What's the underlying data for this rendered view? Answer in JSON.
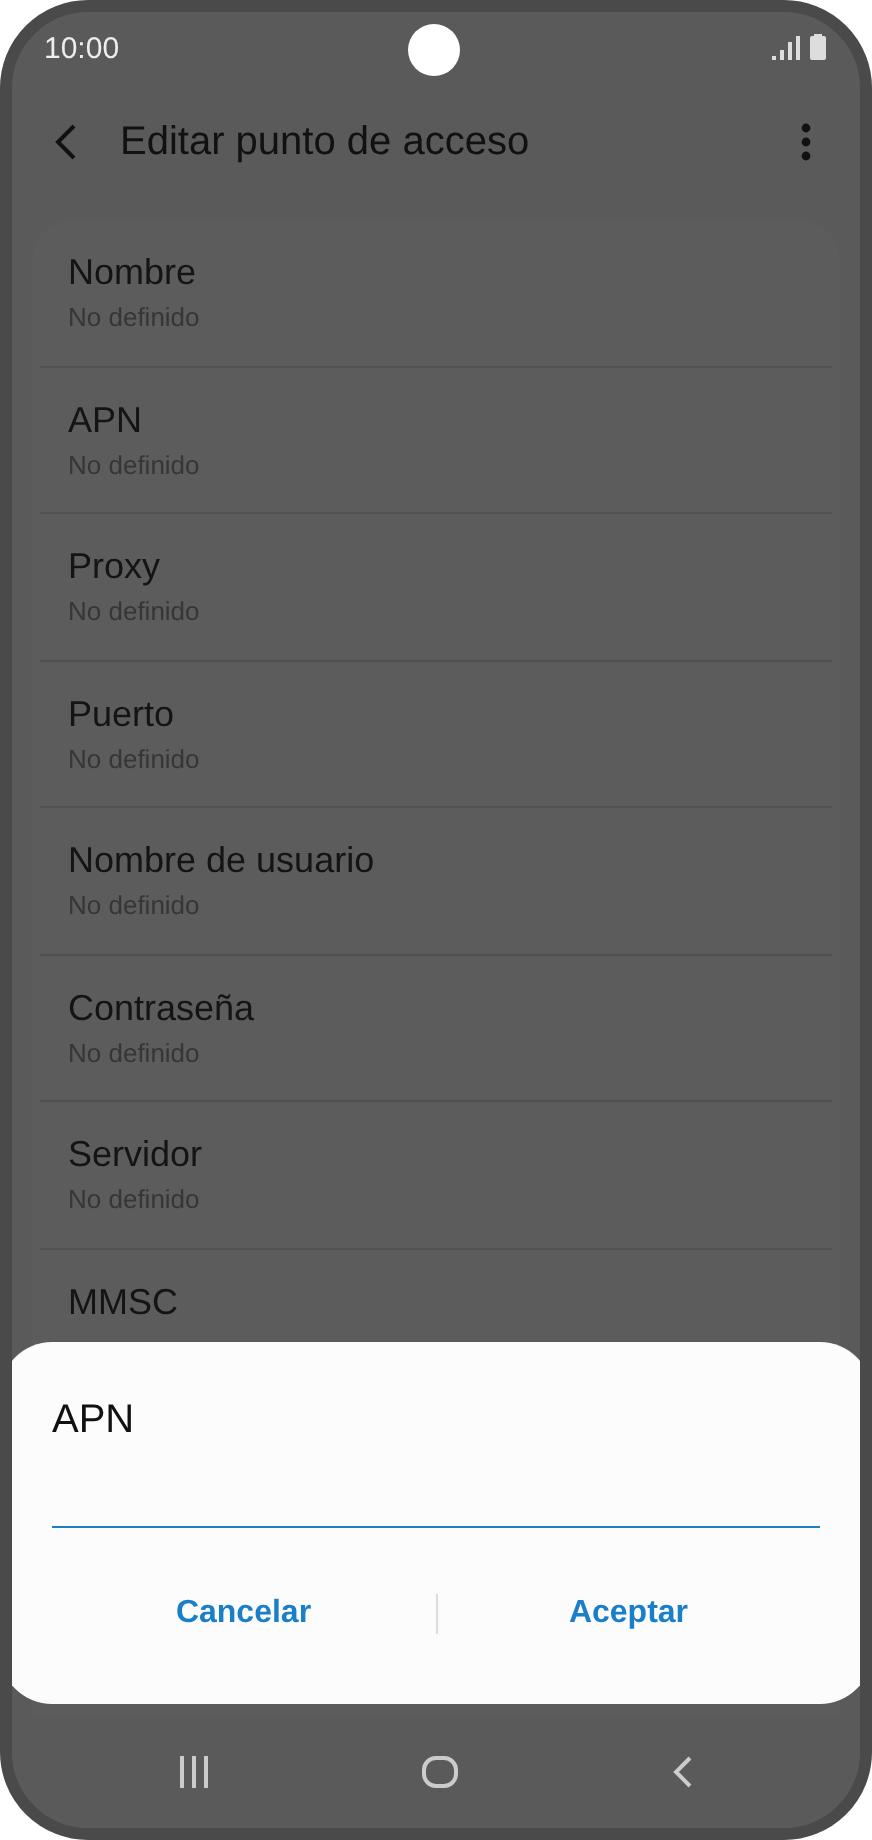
{
  "status_bar": {
    "time": "10:00"
  },
  "app_bar": {
    "title": "Editar punto de acceso"
  },
  "fields": [
    {
      "label": "Nombre",
      "value": "No definido"
    },
    {
      "label": "APN",
      "value": "No definido"
    },
    {
      "label": "Proxy",
      "value": "No definido"
    },
    {
      "label": "Puerto",
      "value": "No definido"
    },
    {
      "label": "Nombre de usuario",
      "value": "No definido"
    },
    {
      "label": "Contraseña",
      "value": "No definido"
    },
    {
      "label": "Servidor",
      "value": "No definido"
    },
    {
      "label": "MMSC"
    }
  ],
  "dialog": {
    "title": "APN",
    "buttons": [
      "Cancelar",
      "Aceptar"
    ]
  }
}
